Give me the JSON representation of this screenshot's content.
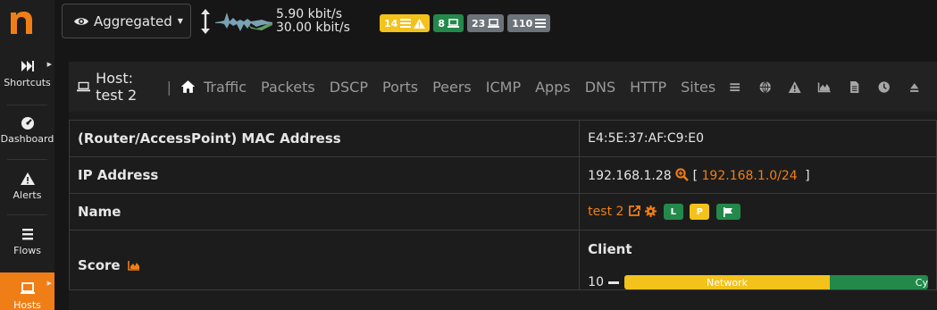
{
  "sidebar": {
    "logo": "n",
    "items": [
      {
        "label": "Shortcuts",
        "icon": "fast-forward-icon"
      },
      {
        "label": "Dashboard",
        "icon": "gauge-icon"
      },
      {
        "label": "Alerts",
        "icon": "warning-icon"
      },
      {
        "label": "Flows",
        "icon": "bars-icon"
      },
      {
        "label": "Hosts",
        "icon": "laptop-icon",
        "active": true
      }
    ]
  },
  "topbar": {
    "view_selector": "Aggregated",
    "rate_up": "5.90 kbit/s",
    "rate_down": "30.00 kbit/s",
    "badges": [
      {
        "count": "14",
        "color": "#f3c21b",
        "icons": [
          "list-icon",
          "warning-icon"
        ]
      },
      {
        "count": "8",
        "color": "#23894b",
        "icons": [
          "laptop-icon"
        ]
      },
      {
        "count": "23",
        "color": "#6d737a",
        "icons": [
          "laptop-icon"
        ]
      },
      {
        "count": "110",
        "color": "#6d737a",
        "icons": [
          "list-icon"
        ]
      }
    ]
  },
  "subnav": {
    "host_label": "Host: test 2",
    "divider": "|",
    "tabs": [
      "Traffic",
      "Packets",
      "DSCP",
      "Ports",
      "Peers",
      "ICMP",
      "Apps",
      "DNS",
      "HTTP",
      "Sites"
    ],
    "icons": [
      "list-icon",
      "globe-icon",
      "warning-icon",
      "area-chart-icon",
      "document-icon",
      "clock-icon",
      "eject-icon"
    ]
  },
  "details": {
    "mac_label": "(Router/AccessPoint) MAC Address",
    "mac_value": "E4:5E:37:AF:C9:E0",
    "ip_label": "IP Address",
    "ip_value": "192.168.1.28",
    "ip_bracket_open": "[",
    "ip_network": "192.168.1.0/24",
    "ip_bracket_close": "]",
    "name_label": "Name",
    "name_value": "test 2",
    "name_badges": [
      "L",
      "P"
    ],
    "score_label": "Score",
    "client_title": "Client",
    "client_score": "10",
    "bar_network_label": "Network",
    "bar_cy_label": "Cy"
  },
  "colors": {
    "accent": "#f07e16",
    "warning": "#f3c21b",
    "success": "#23894b",
    "neutral": "#6d737a"
  }
}
